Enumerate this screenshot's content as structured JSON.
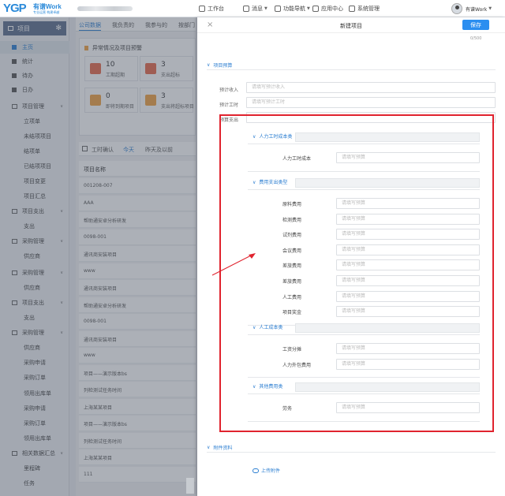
{
  "header": {
    "logo_text": "YGP",
    "brand": "有谱Work",
    "brand_sub": "专业运营 构建卓越",
    "nav": [
      {
        "label": "工作台",
        "icon": "monitor-icon"
      },
      {
        "label": "消息",
        "icon": "bell-icon"
      },
      {
        "label": "功能导航",
        "icon": "compass-icon"
      },
      {
        "label": "应用中心",
        "icon": "grid-icon"
      },
      {
        "label": "系统管理",
        "icon": "gear-icon"
      }
    ],
    "user_name": "有谱Work"
  },
  "sidebar": {
    "title": "项目",
    "items": [
      {
        "label": "主页",
        "kind": "top",
        "active": true
      },
      {
        "label": "统计",
        "kind": "top"
      },
      {
        "label": "待办",
        "kind": "top"
      },
      {
        "label": "日办",
        "kind": "top"
      },
      {
        "label": "项目管理",
        "kind": "grp"
      },
      {
        "label": "立项单",
        "kind": "sub"
      },
      {
        "label": "未结项项目",
        "kind": "sub"
      },
      {
        "label": "结项单",
        "kind": "sub"
      },
      {
        "label": "已结项项目",
        "kind": "sub"
      },
      {
        "label": "项目变更",
        "kind": "sub"
      },
      {
        "label": "项目汇总",
        "kind": "sub"
      },
      {
        "label": "项目支出",
        "kind": "grp"
      },
      {
        "label": "支出",
        "kind": "sub"
      },
      {
        "label": "采购管理",
        "kind": "grp"
      },
      {
        "label": "供应商",
        "kind": "sub"
      },
      {
        "label": "采购管理",
        "kind": "grp"
      },
      {
        "label": "供应商",
        "kind": "sub"
      },
      {
        "label": "项目支出",
        "kind": "grp"
      },
      {
        "label": "支出",
        "kind": "sub"
      },
      {
        "label": "采购管理",
        "kind": "grp"
      },
      {
        "label": "供应商",
        "kind": "sub"
      },
      {
        "label": "采购申请",
        "kind": "sub"
      },
      {
        "label": "采购订单",
        "kind": "sub"
      },
      {
        "label": "领用出库单",
        "kind": "sub"
      },
      {
        "label": "采购申请",
        "kind": "sub"
      },
      {
        "label": "采购订单",
        "kind": "sub"
      },
      {
        "label": "领用出库单",
        "kind": "sub"
      },
      {
        "label": "相关数据汇总",
        "kind": "grp"
      },
      {
        "label": "里程碑",
        "kind": "sub"
      },
      {
        "label": "任务",
        "kind": "sub"
      }
    ]
  },
  "middle": {
    "tabs": [
      "公司数据",
      "我负责的",
      "我参与的",
      "按部门"
    ],
    "warning_title": "异常情况及项目预警",
    "cards": [
      {
        "num": "10",
        "label": "工期超期",
        "color": "#e8694a"
      },
      {
        "num": "3",
        "label": "支出超标",
        "color": "#e8694a"
      },
      {
        "num": "0",
        "label": "即将到期项目",
        "color": "#f0a040"
      },
      {
        "num": "3",
        "label": "支出将超标项目",
        "color": "#f0a040"
      }
    ],
    "time_tabs": [
      "工时确认",
      "今天",
      "昨天及以前"
    ],
    "list_header": "项目名称",
    "rows": [
      "001208-007",
      "AAA",
      "帮助通安卓分析研发",
      "0098-001",
      "通讯商安装项目",
      "www",
      "通讯商安装项目",
      "帮助通安卓分析研发",
      "0098-001",
      "通讯商安装项目",
      "www",
      "项目——演示版本bs",
      "列检测试任务时间",
      "上海某某项目",
      "项目——演示版本bs",
      "列检测试任务时间",
      "上海某某项目",
      "111"
    ]
  },
  "drawer": {
    "title": "新建项目",
    "save_label": "保存",
    "counter": "0/500",
    "section_budget": "项目预算",
    "fields": [
      {
        "label": "预计收入",
        "placeholder": "请填写预计收入"
      },
      {
        "label": "预计工时",
        "placeholder": "请填写预计工时",
        "unit": "小时"
      },
      {
        "label": "预算支出"
      }
    ],
    "groups": [
      {
        "title": "人力工时成本类",
        "items": [
          "人力工时成本"
        ]
      },
      {
        "title": "费用支出类型",
        "items": [
          "原料费用",
          "检测费用",
          "试剂费用",
          "会议费用",
          "差旅费用",
          "差旅费用",
          "人工费用",
          "项目奖金"
        ]
      },
      {
        "title": "人工成本类",
        "items": [
          "工资分摊",
          "人力外包费用"
        ]
      },
      {
        "title": "其他费用类",
        "items": [
          "劳务"
        ]
      }
    ],
    "input_placeholder": "请填写预算",
    "section_attach": "附件资料",
    "upload_label": "上传附件"
  },
  "colors": {
    "accent": "#2b8ef0",
    "highlight_box": "#e0232e",
    "sidebar_head": "#5b6e8c"
  }
}
